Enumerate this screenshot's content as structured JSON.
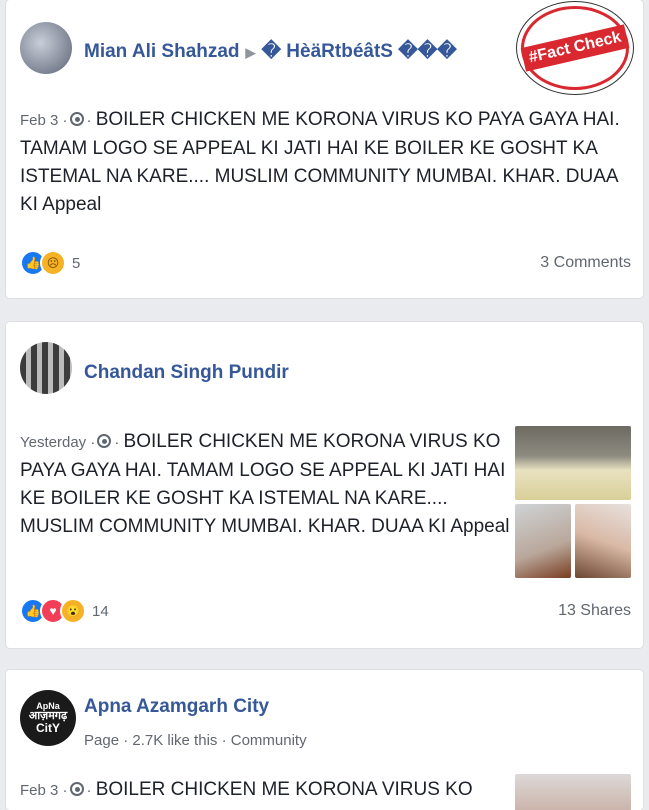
{
  "badge": {
    "text": "#Fact Check"
  },
  "posts": [
    {
      "author": "Mian Ali Shahzad",
      "group": "� HèäRtbéâtS ���",
      "timestamp": "Feb 3",
      "text": "BOILER CHICKEN ME KORONA VIRUS KO PAYA GAYA HAI. TAMAM LOGO SE APPEAL KI JATI HAI KE BOILER KE GOSHT KA ISTEMAL NA KARE.... MUSLIM COMMUNITY MUMBAI. KHAR. DUAA KI Appeal",
      "reaction_count": "5",
      "stat": "3 Comments"
    },
    {
      "author": "Chandan Singh Pundir",
      "timestamp": "Yesterday",
      "text": "BOILER CHICKEN ME KORONA VIRUS KO PAYA GAYA HAI. TAMAM LOGO SE APPEAL KI JATI HAI KE BOILER KE GOSHT KA ISTEMAL NA KARE.... MUSLIM COMMUNITY MUMBAI. KHAR. DUAA KI Appeal",
      "reaction_count": "14",
      "stat": "13 Shares"
    },
    {
      "author": "Apna Azamgarh City",
      "meta": "Page · 2.7K like this · Community",
      "avatar_text": [
        "ApNa",
        "आज़मगढ़",
        "CitY"
      ],
      "timestamp": "Feb 3",
      "text": "BOILER CHICKEN ME KORONA VIRUS KO"
    }
  ]
}
